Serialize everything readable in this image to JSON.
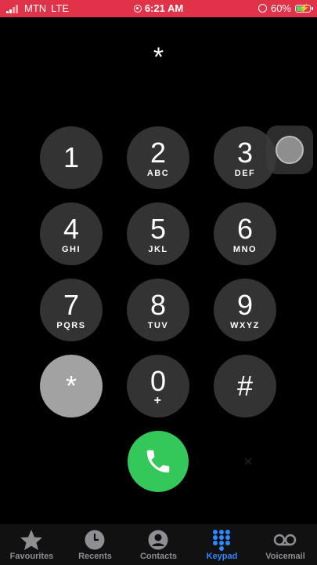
{
  "status_bar": {
    "carrier": "MTN",
    "network": "LTE",
    "time": "6:21 AM",
    "battery_percent": "60%",
    "battery_level": 0.6,
    "background_color": "#e0334a"
  },
  "entered_number": "*",
  "keypad": [
    {
      "digit": "1",
      "letters": ""
    },
    {
      "digit": "2",
      "letters": "ABC"
    },
    {
      "digit": "3",
      "letters": "DEF"
    },
    {
      "digit": "4",
      "letters": "GHI"
    },
    {
      "digit": "5",
      "letters": "JKL"
    },
    {
      "digit": "6",
      "letters": "MNO"
    },
    {
      "digit": "7",
      "letters": "PQRS"
    },
    {
      "digit": "8",
      "letters": "TUV"
    },
    {
      "digit": "9",
      "letters": "WXYZ"
    },
    {
      "digit": "*",
      "letters": ""
    },
    {
      "digit": "0",
      "letters": "+"
    },
    {
      "digit": "#",
      "letters": ""
    }
  ],
  "pressed_key": "*",
  "call_button": {
    "icon": "phone-icon",
    "color": "#34c759"
  },
  "tabs": [
    {
      "label": "Favourites",
      "icon": "star-icon",
      "active": false
    },
    {
      "label": "Recents",
      "icon": "clock-icon",
      "active": false
    },
    {
      "label": "Contacts",
      "icon": "person-circle-icon",
      "active": false
    },
    {
      "label": "Keypad",
      "icon": "keypad-grid-icon",
      "active": true
    },
    {
      "label": "Voicemail",
      "icon": "voicemail-icon",
      "active": false
    }
  ],
  "accent_color": "#2f88ff"
}
